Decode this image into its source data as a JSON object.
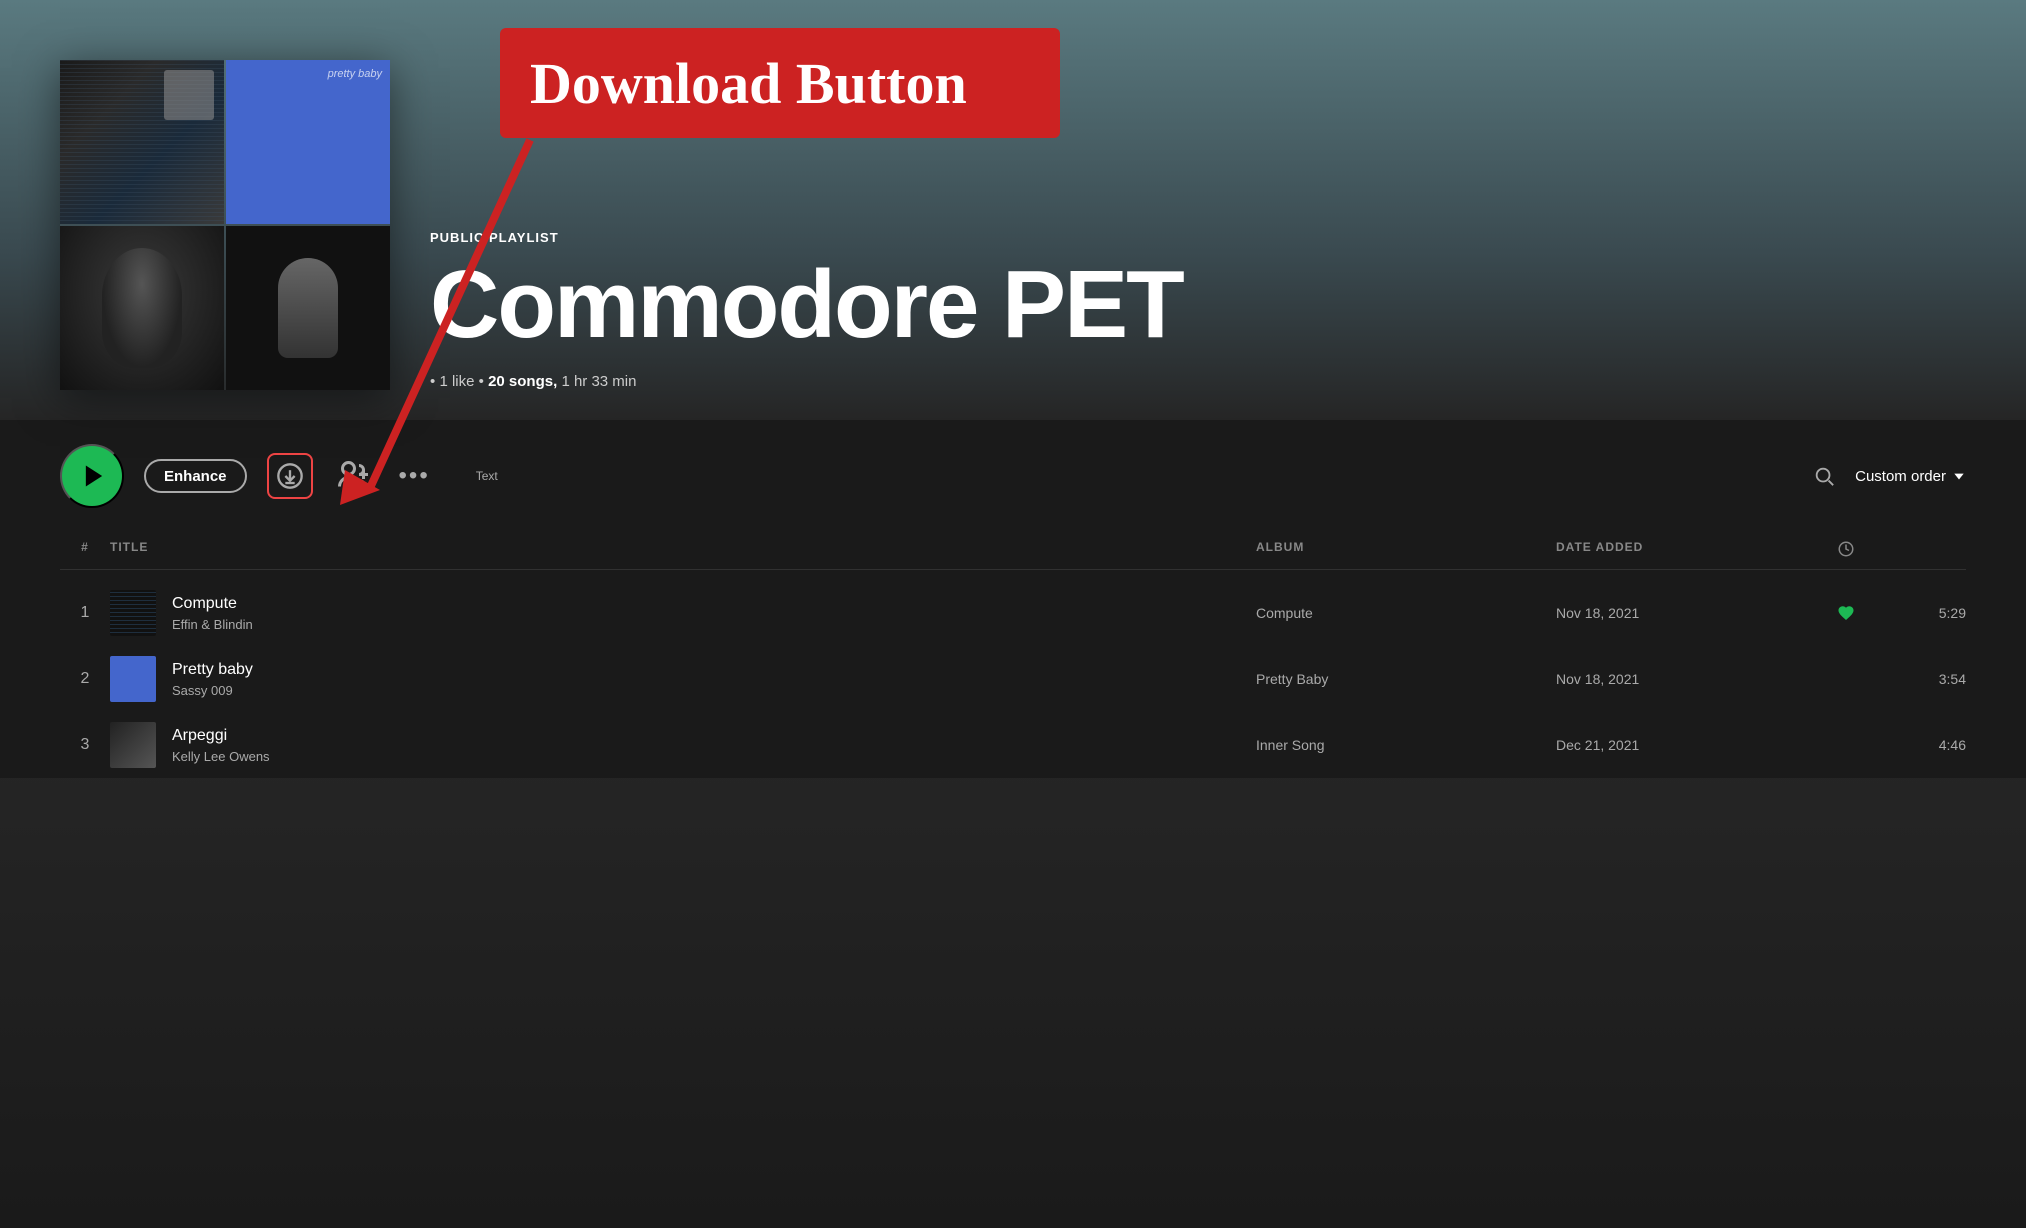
{
  "hero": {
    "playlist_type": "PUBLIC PLAYLIST",
    "playlist_title": "Commodore PET",
    "meta_likes": "1 like",
    "meta_bullet1": "•",
    "meta_songs": "20 songs,",
    "meta_duration": "1 hr 33 min"
  },
  "toolbar": {
    "play_label": "▶",
    "enhance_label": "Enhance",
    "text_label": "Text",
    "custom_order_label": "Custom order"
  },
  "track_header": {
    "col_num": "#",
    "col_title": "TITLE",
    "col_album": "ALBUM",
    "col_date": "DATE ADDED",
    "col_duration": "⏱"
  },
  "tracks": [
    {
      "num": "1",
      "title": "Compute",
      "artist": "Effin & Blindin",
      "album": "Compute",
      "date": "Nov 18, 2021",
      "duration": "5:29",
      "liked": true,
      "thumb_bg": "#1a1a2a"
    },
    {
      "num": "2",
      "title": "Pretty baby",
      "artist": "Sassy 009",
      "album": "Pretty Baby",
      "date": "Nov 18, 2021",
      "duration": "3:54",
      "liked": false,
      "thumb_bg": "#4466cc"
    },
    {
      "num": "3",
      "title": "Arpeggi",
      "artist": "Kelly Lee Owens",
      "album": "Inner Song",
      "date": "Dec 21, 2021",
      "duration": "4:46",
      "liked": false,
      "thumb_bg": "#2a2a2a"
    }
  ],
  "annotation": {
    "label": "Download Button"
  }
}
